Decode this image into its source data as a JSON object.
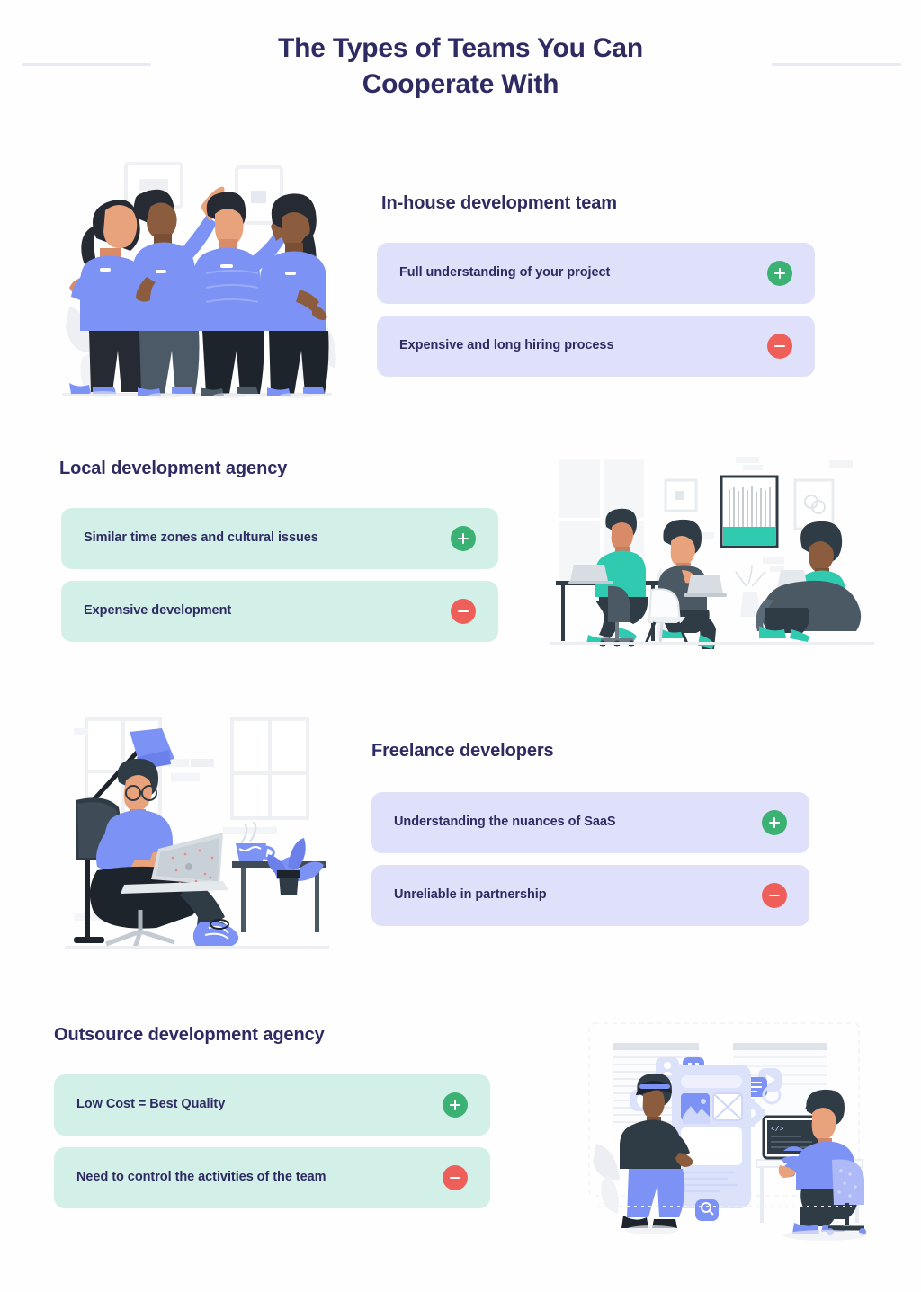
{
  "page": {
    "title": "The Types of Teams You Can Cooperate With",
    "title_line1": "The Types of Teams You Can",
    "title_line2": "Cooperate With",
    "background": "#fefeff"
  },
  "colors": {
    "heading": "#2d2b62",
    "card_lavender": "#dfe1fb",
    "card_mint": "#d3f0e8",
    "badge_plus": "#3bb273",
    "badge_minus": "#ef5f5a",
    "rule": "#e7eaf3",
    "illustration_blue": "#7d92f5",
    "illustration_teal": "#2fcab0",
    "illustration_dark": "#2f3b45"
  },
  "sections": [
    {
      "id": "in-house",
      "heading": "In-house development team",
      "card_theme": "lavender",
      "illustration": "team-high-five-illustration",
      "items": [
        {
          "label": "Full understanding of your project",
          "type": "pro",
          "icon": "plus-icon"
        },
        {
          "label": "Expensive and long hiring process",
          "type": "con",
          "icon": "minus-icon"
        }
      ]
    },
    {
      "id": "local-agency",
      "heading": "Local development agency",
      "card_theme": "mint",
      "illustration": "office-meeting-illustration",
      "items": [
        {
          "label": "Similar time zones and cultural issues",
          "type": "pro",
          "icon": "plus-icon"
        },
        {
          "label": "Expensive development",
          "type": "con",
          "icon": "minus-icon"
        }
      ]
    },
    {
      "id": "freelance",
      "heading": "Freelance developers",
      "card_theme": "lavender",
      "illustration": "freelancer-armchair-illustration",
      "items": [
        {
          "label": "Understanding the nuances of SaaS",
          "type": "pro",
          "icon": "plus-icon"
        },
        {
          "label": "Unreliable in partnership",
          "type": "con",
          "icon": "minus-icon"
        }
      ]
    },
    {
      "id": "outsource",
      "heading": "Outsource development agency",
      "card_theme": "mint",
      "illustration": "app-design-team-illustration",
      "items": [
        {
          "label": "Low Cost = Best Quality",
          "type": "pro",
          "icon": "plus-icon"
        },
        {
          "label": "Need to control the activities of the team",
          "type": "con",
          "icon": "minus-icon"
        }
      ]
    }
  ]
}
